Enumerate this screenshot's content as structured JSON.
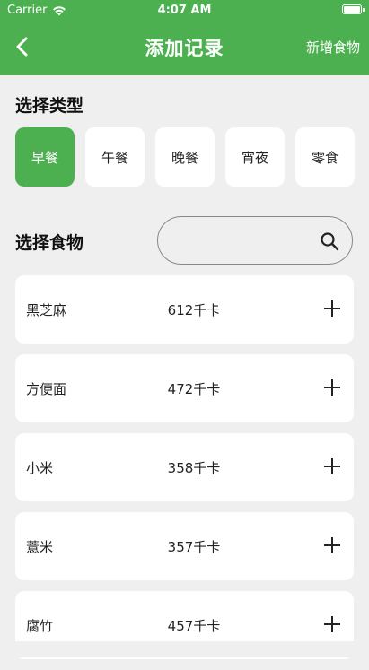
{
  "status_bar": {
    "carrier": "Carrier",
    "time": "4:07 AM"
  },
  "nav": {
    "title": "添加记录",
    "action_label": "新增食物"
  },
  "type_section": {
    "title": "选择类型",
    "types": [
      {
        "label": "早餐",
        "active": true
      },
      {
        "label": "午餐",
        "active": false
      },
      {
        "label": "晚餐",
        "active": false
      },
      {
        "label": "宵夜",
        "active": false
      },
      {
        "label": "零食",
        "active": false
      }
    ]
  },
  "food_section": {
    "title": "选择食物",
    "search": {
      "value": "",
      "placeholder": ""
    },
    "foods": [
      {
        "name": "黑芝麻",
        "calories": "612千卡"
      },
      {
        "name": "方便面",
        "calories": "472千卡"
      },
      {
        "name": "小米",
        "calories": "358千卡"
      },
      {
        "name": "薏米",
        "calories": "357千卡"
      },
      {
        "name": "腐竹",
        "calories": "457千卡"
      }
    ]
  },
  "theme": {
    "accent": "#4caf50",
    "background": "#efefef"
  }
}
